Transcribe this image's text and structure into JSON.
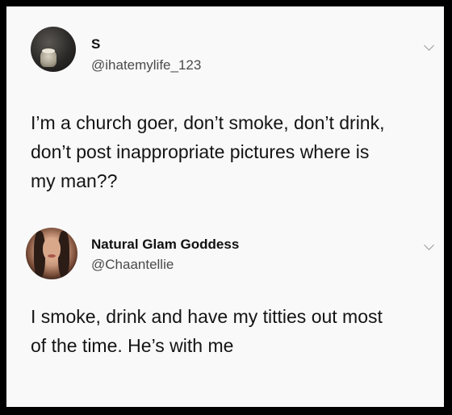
{
  "tweets": [
    {
      "display_name": "S",
      "handle": "@ihatemylife_123",
      "text_lines": [
        "I’m a church goer, don’t smoke, don’t drink,",
        "don’t post inappropriate pictures where is",
        "my man??"
      ]
    },
    {
      "display_name": "Natural Glam Goddess",
      "handle": "@Chaantellie",
      "text_lines": [
        "I smoke, drink and have my titties out most",
        "of the time. He’s with me"
      ]
    }
  ],
  "icons": {
    "menu": "chevron-down-icon"
  },
  "colors": {
    "border": "#000000",
    "background": "#f9f9f9",
    "text": "#141414",
    "handle": "#4a4a4a"
  }
}
